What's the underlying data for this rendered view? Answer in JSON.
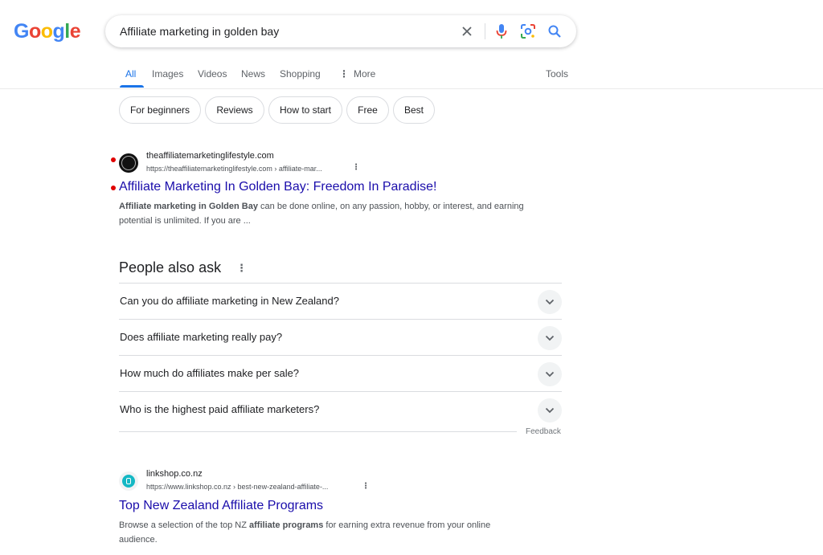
{
  "logo": {
    "letters": [
      "G",
      "o",
      "o",
      "g",
      "l",
      "e"
    ],
    "colors": [
      "#4285f4",
      "#ea4335",
      "#fbbc05",
      "#4285f4",
      "#34a853",
      "#ea4335"
    ]
  },
  "search": {
    "query": "Affiliate marketing in golden bay",
    "icons": [
      "close-icon",
      "microphone-icon",
      "lens-icon",
      "search-icon"
    ]
  },
  "tabs": [
    {
      "label": "All",
      "active": true
    },
    {
      "label": "Images",
      "active": false
    },
    {
      "label": "Videos",
      "active": false
    },
    {
      "label": "News",
      "active": false
    },
    {
      "label": "Shopping",
      "active": false
    },
    {
      "label": "More",
      "active": false
    }
  ],
  "tools_label": "Tools",
  "chips": [
    "For beginners",
    "Reviews",
    "How to start",
    "Free",
    "Best"
  ],
  "results": [
    {
      "site_name": "theaffiliatemarketinglifestyle.com",
      "url": "https://theaffiliatemarketinglifestyle.com › affiliate-mar...",
      "title": "Affiliate Marketing In Golden Bay: Freedom In Paradise!",
      "snippet_bold": "Affiliate marketing in Golden Bay",
      "snippet_rest": " can be done online, on any passion, hobby, or interest, and earning potential is unlimited. If you are ..."
    },
    {
      "site_name": "linkshop.co.nz",
      "url": "https://www.linkshop.co.nz › best-new-zealand-affiliate-...",
      "title": "Top New Zealand Affiliate Programs",
      "snippet_pre": "Browse a selection of the top NZ ",
      "snippet_bold": "affiliate programs",
      "snippet_rest": " for earning extra revenue from your online audience."
    }
  ],
  "people_also_ask": {
    "title": "People also ask",
    "questions": [
      "Can you do affiliate marketing in New Zealand?",
      "Does affiliate marketing really pay?",
      "How much do affiliates make per sale?",
      "Who is the highest paid affiliate marketers?"
    ],
    "feedback_label": "Feedback"
  },
  "colors": {
    "link": "#1a0dab",
    "accent": "#1a73e8",
    "marker": "#e00000"
  }
}
